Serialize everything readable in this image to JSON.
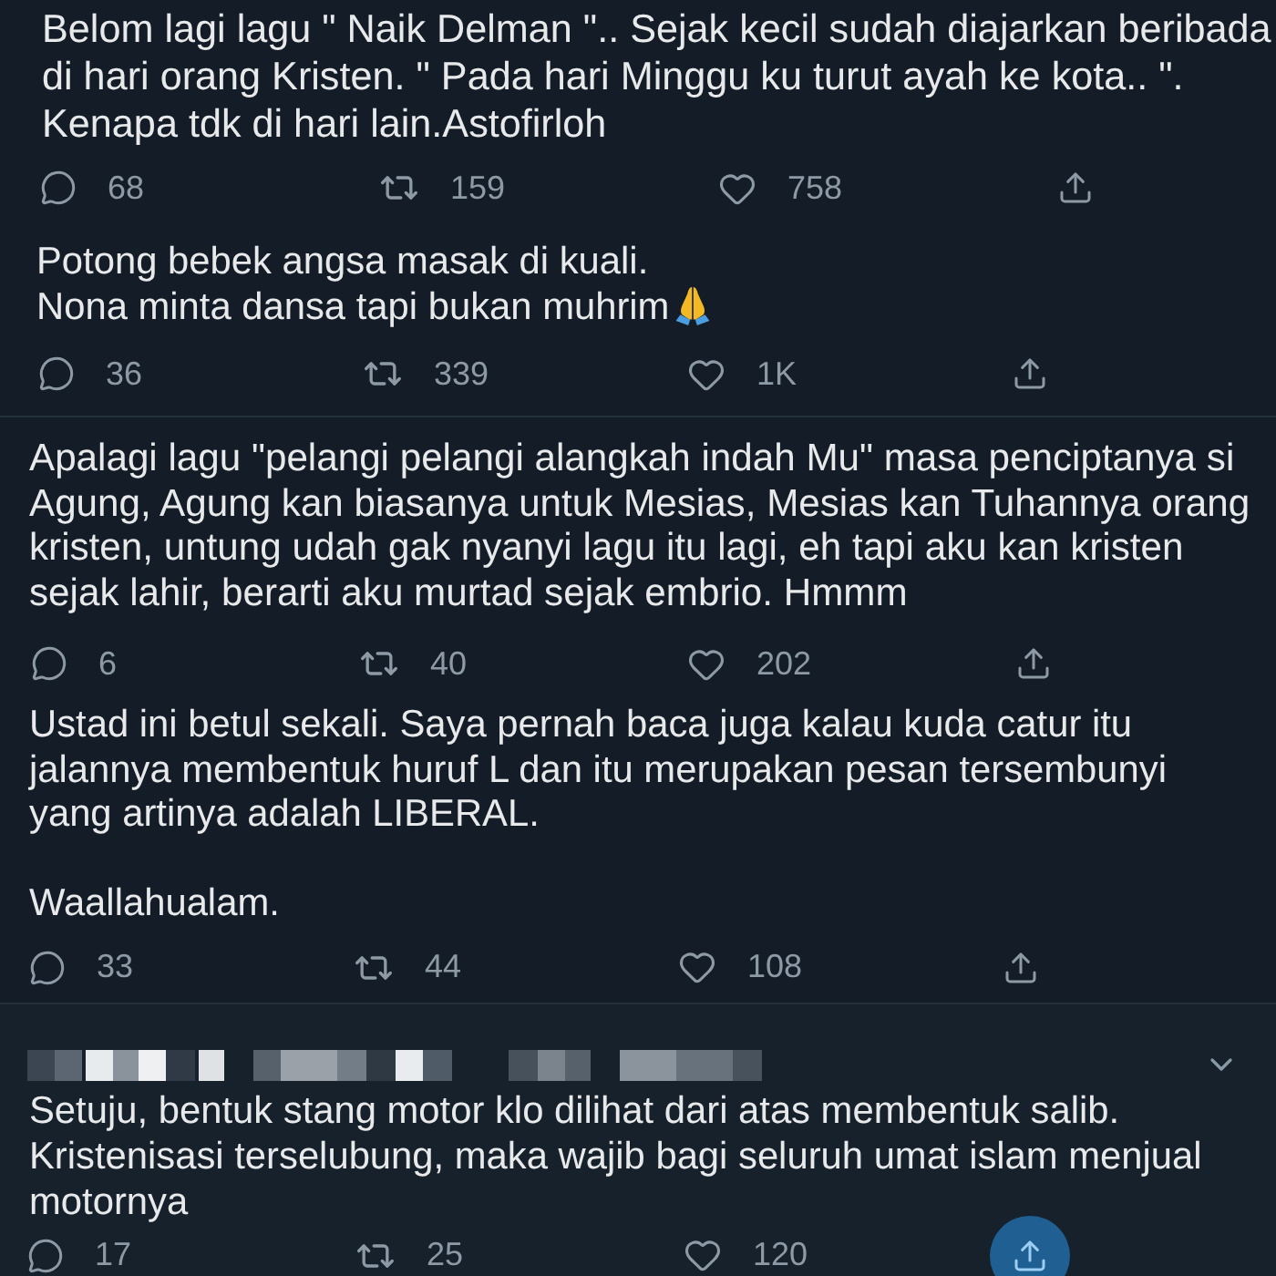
{
  "tweets": [
    {
      "text": "Belom lagi lagu \" Naik Delman \".. Sejak kecil sudah diajarkan beribada\ndi hari orang Kristen. \" Pada hari Minggu ku turut ayah ke kota.. \".\nKenapa tdk di hari lain.Astofirloh",
      "trailing_emoji": false,
      "name_pixelated": false,
      "menu": false,
      "replies": "68",
      "retweets": "159",
      "likes": "758",
      "share_hovered": false
    },
    {
      "text": "Potong bebek angsa masak di kuali.\nNona minta dansa tapi bukan muhrim",
      "trailing_emoji": true,
      "name_pixelated": false,
      "menu": false,
      "replies": "36",
      "retweets": "339",
      "likes": "1K",
      "share_hovered": false
    },
    {
      "text": "Apalagi lagu \"pelangi pelangi alangkah indah Mu\" masa penciptanya si\nAgung, Agung kan biasanya untuk Mesias, Mesias kan Tuhannya orang\nkristen, untung udah gak nyanyi lagu itu lagi, eh tapi aku kan kristen\nsejak lahir, berarti aku murtad sejak embrio. Hmmm",
      "trailing_emoji": false,
      "name_pixelated": false,
      "menu": false,
      "replies": "6",
      "retweets": "40",
      "likes": "202",
      "share_hovered": false
    },
    {
      "text": "Ustad ini betul sekali. Saya pernah baca juga kalau kuda catur itu\njalannya membentuk huruf L dan itu merupakan pesan tersembunyi\nyang artinya adalah LIBERAL.\n\nWaallahualam.",
      "trailing_emoji": false,
      "name_pixelated": false,
      "menu": false,
      "replies": "33",
      "retweets": "44",
      "likes": "108",
      "share_hovered": false
    },
    {
      "text": "Setuju, bentuk stang motor klo dilihat dari atas membentuk salib.\nKristenisasi terselubung, maka wajib bagi seluruh umat islam menjual\nmotornya",
      "trailing_emoji": false,
      "name_pixelated": true,
      "menu": true,
      "replies": "17",
      "retweets": "25",
      "likes": "120",
      "share_hovered": true
    }
  ]
}
